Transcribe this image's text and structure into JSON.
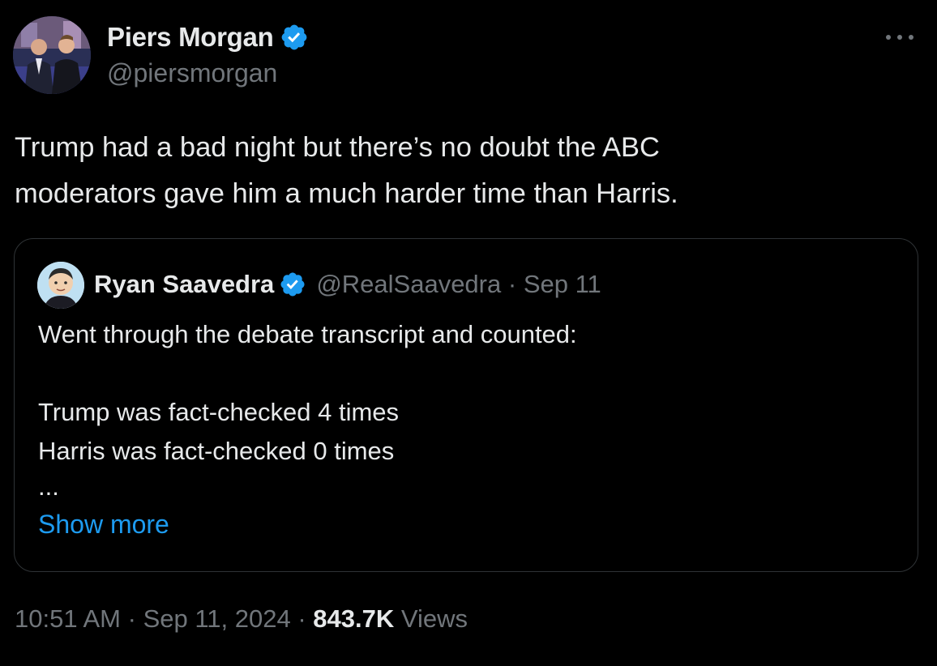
{
  "author": {
    "name": "Piers Morgan",
    "handle": "@piersmorgan",
    "verified": true
  },
  "tweet": {
    "text_line1": "Trump had a bad night but there’s no doubt the ABC",
    "text_line2": "moderators gave him a much harder time than Harris."
  },
  "quote": {
    "name": "Ryan Saavedra",
    "handle": "@RealSaavedra",
    "separator": "·",
    "date": "Sep 11",
    "verified": true,
    "lines": [
      "Went through the debate transcript and counted:",
      "",
      "Trump was fact-checked 4 times",
      "Harris was fact-checked 0 times",
      "..."
    ],
    "show_more_label": "Show more"
  },
  "footer": {
    "time": "10:51 AM",
    "sep1": "·",
    "date": "Sep 11, 2024",
    "sep2": "·",
    "views_count": "843.7K",
    "views_label": "Views"
  },
  "icons": {
    "more": "more-horizontal-icon",
    "verified": "verified-badge-icon"
  },
  "colors": {
    "background": "#000000",
    "text": "#e7e9ea",
    "muted": "#71767b",
    "link": "#1d9bf0",
    "verified": "#1d9bf0",
    "border": "#2f3336"
  }
}
